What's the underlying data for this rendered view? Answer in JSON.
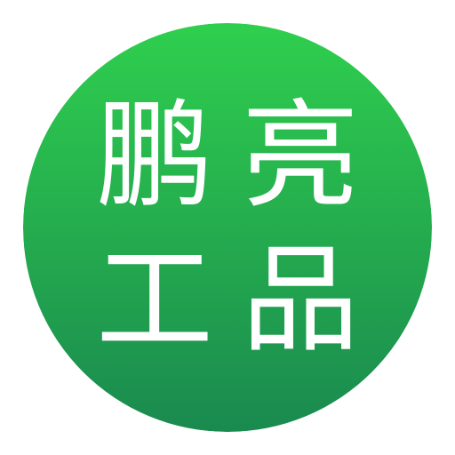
{
  "logo": {
    "chars": [
      "鹏",
      "亮",
      "工",
      "品"
    ],
    "colors": {
      "gradient_top": "#2fcf4e",
      "gradient_bottom": "#1a8a4f",
      "text": "#ffffff",
      "background": "#ffffff"
    }
  }
}
